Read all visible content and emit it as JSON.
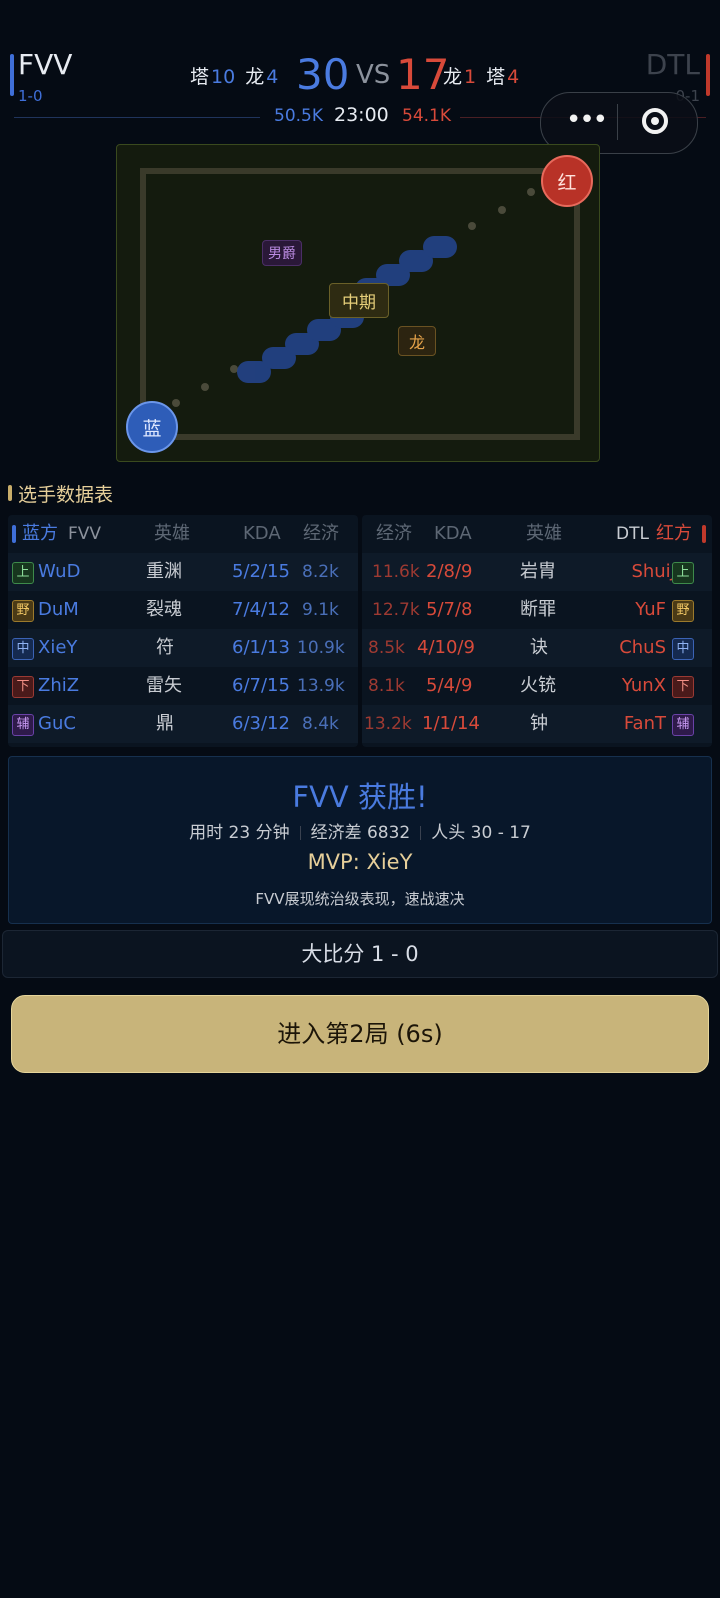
{
  "header": {
    "left_team": {
      "name": "FVV",
      "record": "1-0",
      "tower_label": "塔",
      "towers": "10",
      "dragon_label": "龙",
      "dragons": "4",
      "kills": "30",
      "gold": "50.5K"
    },
    "vs": "VS",
    "right_team": {
      "name": "DTL",
      "record": "0-1",
      "dragon_label": "龙",
      "dragons": "1",
      "tower_label": "塔",
      "towers": "4",
      "kills": "17",
      "gold": "54.1K"
    },
    "time": "23:00",
    "capsule": {
      "more_icon": "more-dots-icon",
      "close_icon": "close-target-icon",
      "more": "•••"
    }
  },
  "map": {
    "blue_base": "蓝",
    "red_base": "红",
    "baron_tag": "男爵",
    "phase_tag": "中期",
    "dragon_tag": "龙"
  },
  "table": {
    "section_title": "选手数据表",
    "left": {
      "side_label": "蓝方",
      "team": "FVV",
      "col_hero": "英雄",
      "col_kda": "KDA",
      "col_eco": "经济",
      "players": [
        {
          "role": "上",
          "name": "WuD",
          "hero": "重渊",
          "kda": "5/2/15",
          "eco": "8.2k"
        },
        {
          "role": "野",
          "name": "DuM",
          "hero": "裂魂",
          "kda": "7/4/12",
          "eco": "9.1k"
        },
        {
          "role": "中",
          "name": "XieY",
          "hero": "符",
          "kda": "6/1/13",
          "eco": "10.9k"
        },
        {
          "role": "下",
          "name": "ZhiZ",
          "hero": "雷矢",
          "kda": "6/7/15",
          "eco": "13.9k"
        },
        {
          "role": "辅",
          "name": "GuC",
          "hero": "鼎",
          "kda": "6/3/12",
          "eco": "8.4k"
        }
      ]
    },
    "right": {
      "side_label": "红方",
      "team": "DTL",
      "col_hero": "英雄",
      "col_kda": "KDA",
      "col_eco": "经济",
      "players": [
        {
          "role": "上",
          "name": "ShuiJ",
          "hero": "岩胄",
          "kda": "2/8/9",
          "eco": "11.6k"
        },
        {
          "role": "野",
          "name": "YuF",
          "hero": "断罪",
          "kda": "5/7/8",
          "eco": "12.7k"
        },
        {
          "role": "中",
          "name": "ChuS",
          "hero": "诀",
          "kda": "4/10/9",
          "eco": "8.5k"
        },
        {
          "role": "下",
          "name": "YunX",
          "hero": "火铳",
          "kda": "5/4/9",
          "eco": "8.1k"
        },
        {
          "role": "辅",
          "name": "FanT",
          "hero": "钟",
          "kda": "1/1/14",
          "eco": "13.2k"
        }
      ]
    }
  },
  "result": {
    "title": "FVV 获胜!",
    "duration": "用时 23 分钟",
    "gold_diff": "经济差 6832",
    "kills": "人头 30 - 17",
    "mvp": "MVP: XieY",
    "desc": "FVV展现统治级表现，速战速决"
  },
  "series": "大比分 1 - 0",
  "next_button": "进入第2局 (6s)"
}
